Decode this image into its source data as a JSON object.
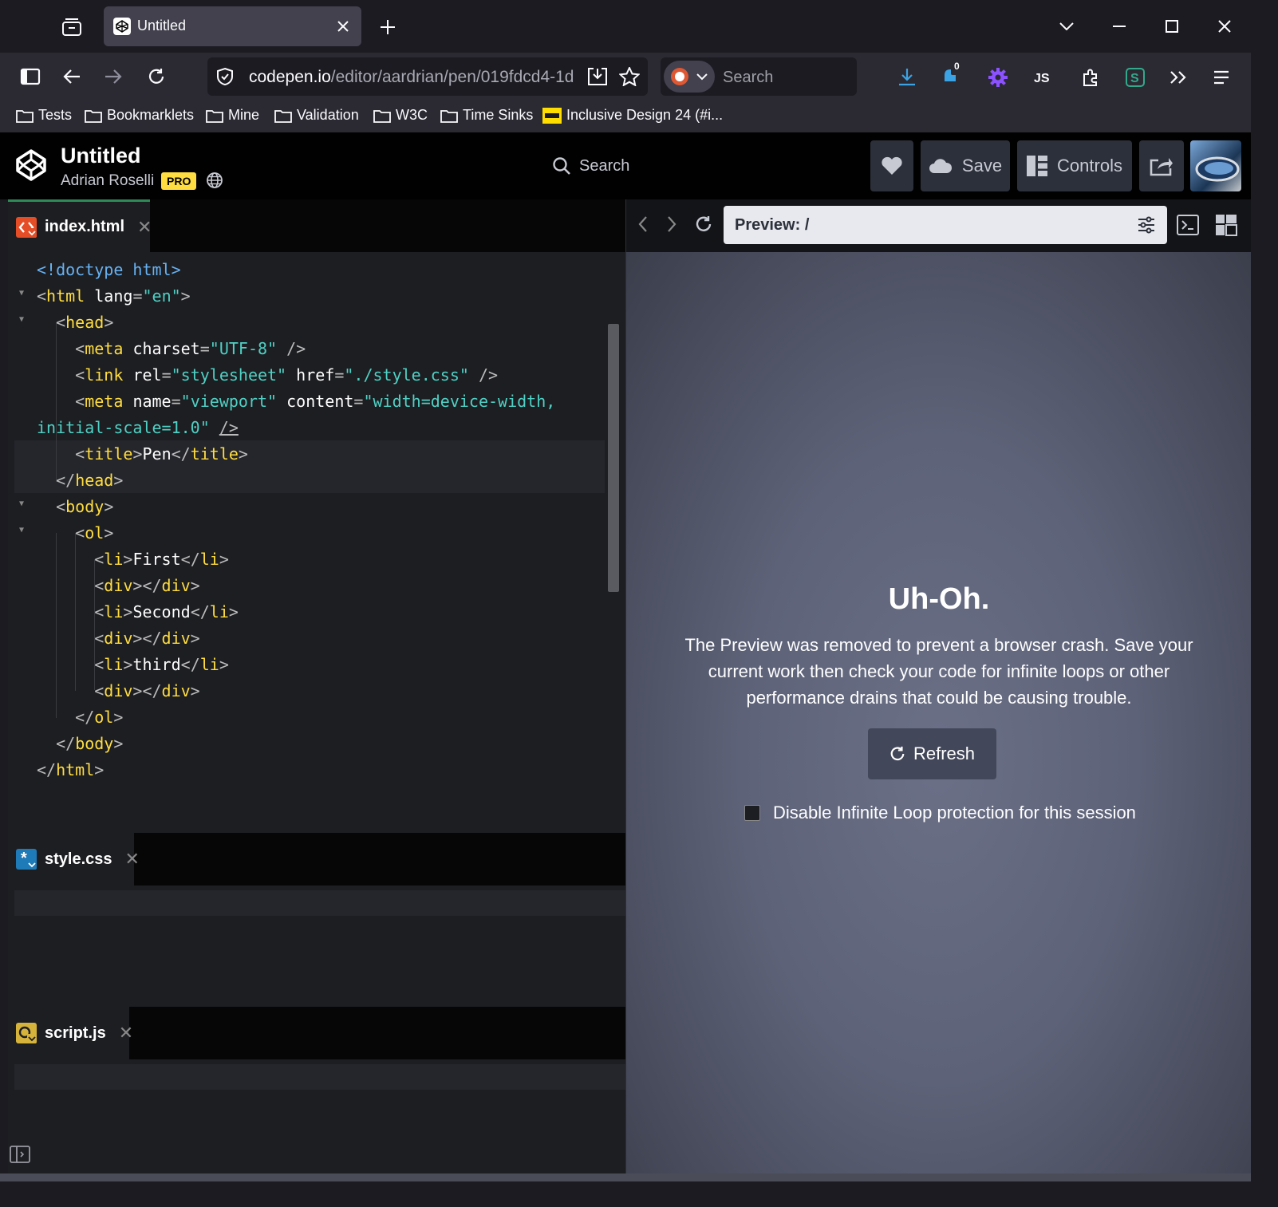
{
  "browser": {
    "tab_title": "Untitled",
    "url_host": "codepen.io",
    "url_path": "/editor/aardrian/pen/019fdcd4-1d",
    "search_placeholder": "Search",
    "notification_count": "0",
    "bookmarks": [
      "Tests",
      "Bookmarklets",
      "Mine",
      "Validation",
      "W3C",
      "Time Sinks",
      "Inclusive Design 24 (#i..."
    ]
  },
  "codepen": {
    "title": "Untitled",
    "user": "Adrian Roselli",
    "pro_badge": "PRO",
    "search_label": "Search",
    "save_label": "Save",
    "controls_label": "Controls"
  },
  "editors": {
    "html_tab": "index.html",
    "css_tab": "style.css",
    "js_tab": "script.js"
  },
  "preview": {
    "url": "Preview: /",
    "title": "Uh-Oh.",
    "message": "The Preview was removed to prevent a browser crash. Save your current work then check your code for infinite loops or other performance drains that could be causing trouble.",
    "refresh_label": "Refresh",
    "checkbox_label": "Disable Infinite Loop protection for this session",
    "checkbox_checked": false
  },
  "colors": {
    "tag": "#ffdd40",
    "string": "#4fd1c5",
    "doctype": "#67b2f3",
    "pro": "#ffdd40"
  }
}
